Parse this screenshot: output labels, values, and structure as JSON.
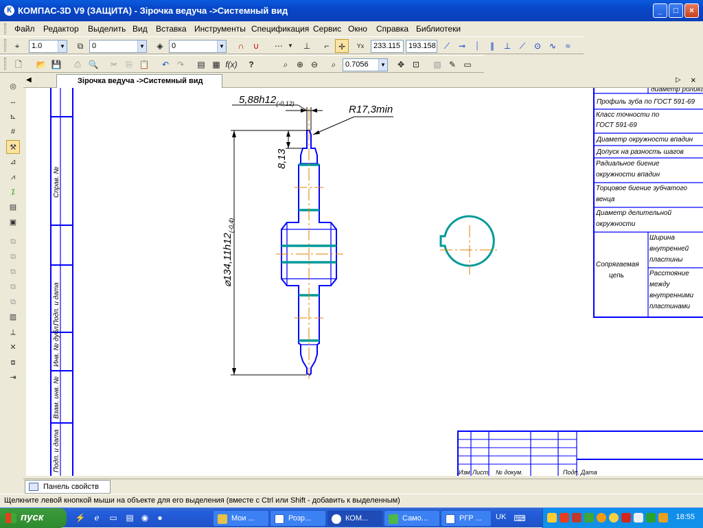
{
  "window": {
    "title": "КОМПАС-3D V9 (ЗАЩИТА) - Зірочка ведуча ->Системный вид",
    "minimize": "_",
    "maximize": "□",
    "close": "×"
  },
  "menu": [
    "Файл",
    "Редактор",
    "Выделить",
    "Вид",
    "Вставка",
    "Инструменты",
    "Спецификация",
    "Сервис",
    "Окно",
    "Справка",
    "Библиотеки"
  ],
  "toolbar1": {
    "line_scale": "1.0",
    "state": "0",
    "layer": "0",
    "coord_x": "233.115",
    "coord_y": "193.158"
  },
  "toolbar2": {
    "zoom": "0.7056"
  },
  "document_tab": "Зірочка ведуча ->Системный вид",
  "drawing": {
    "dim_width": "5,88h12",
    "dim_width_tol": "(-0,12)",
    "dim_radius": "R17,3min",
    "dim_height": "8,13",
    "dim_diameter": "⌀134,11h12",
    "dim_diameter_tol": "(-0,4)",
    "frame_labels": [
      "Справ. №",
      "Подп. и дата",
      "Инв. № дубл.",
      "Взам. инв. №",
      "Подп. и дата"
    ],
    "table_header_cut": "диаметр ролика",
    "table_rows": [
      "Профиль зуба по ГОСТ 591-69",
      "Класс точности по ГОСТ 591-69",
      "Диаметр окружности впадин",
      "Допуск на разность шагов",
      "Радиальное биение окружности впадин",
      "Торцовое биение зубчатого венца",
      "Диаметр делительной окружности"
    ],
    "mating_chain": "Сопрягаемая цепь",
    "mating_items": [
      "Ширина внутренней пластины",
      "Расстояние между внутренними пластинами"
    ],
    "title_block": [
      "Изм",
      "Лист",
      "№ докум.",
      "Подп.",
      "Дата"
    ]
  },
  "properties_tab": "Панель свойств",
  "status": "Щелкните левой кнопкой мыши на объекте для его выделения (вместе с Ctrl или Shift - добавить к выделенным)",
  "taskbar": {
    "start": "пуск",
    "tasks": [
      "Мои ...",
      "Розр...",
      "КОМ...",
      "Само...",
      "РГР ..."
    ],
    "lang": "UK",
    "clock": "18:55"
  },
  "colors": {
    "line": "#0000FF",
    "hub": "#009999",
    "axis": "#E08000",
    "titlebar": "#0A4AC8"
  }
}
